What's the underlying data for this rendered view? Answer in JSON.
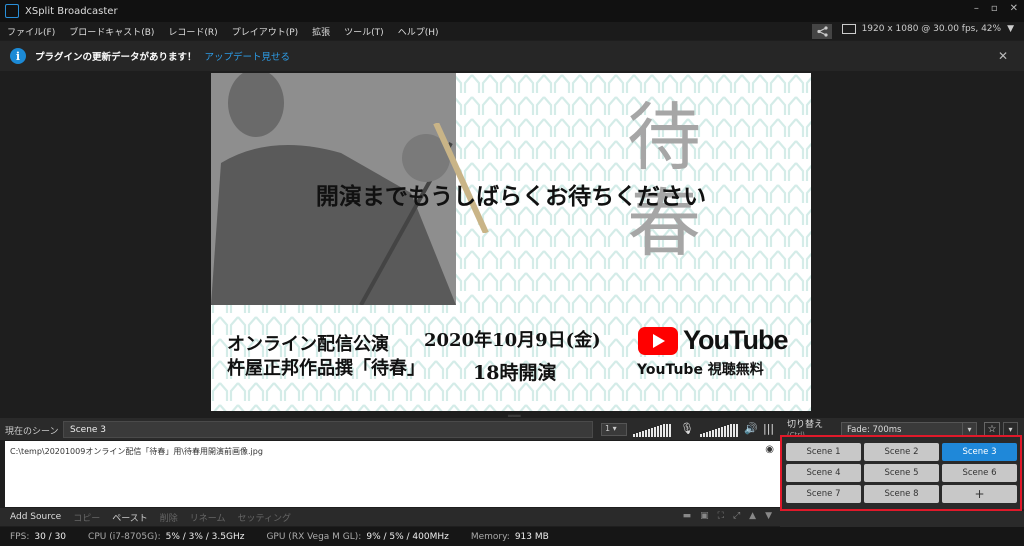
{
  "window": {
    "title": "XSplit Broadcaster",
    "minimize": "–",
    "maximize": "▫",
    "close": "✕"
  },
  "menu": [
    "ファイル(F)",
    "ブロードキャスト(B)",
    "レコード(R)",
    "プレイアウト(P)",
    "拡張",
    "ツール(T)",
    "ヘルプ(H)"
  ],
  "resolution": "1920 x 1080 @ 30.00 fps, 42%",
  "notification": {
    "text": "プラグインの更新データがあります！",
    "link": "アップデート見せる"
  },
  "preview": {
    "big_kanji": "待春",
    "headline": "開演までもうしばらくお待ちください",
    "event_line1": "オンライン配信公演",
    "event_line2": "杵屋正邦作品撰「待春」",
    "date": "2020年10月9日(金)",
    "time": "18時開演",
    "youtube_word": "YouTube",
    "youtube_caption": "YouTube 視聴無料"
  },
  "scene_bar": {
    "label": "現在のシーン",
    "current": "Scene 3",
    "selector": "1"
  },
  "sources": {
    "path": "C:\\temp\\20201009オンライン配信「待春」用\\待春用開演前画像.jpg"
  },
  "source_toolbar": {
    "add": "Add Source",
    "copy": "コピー",
    "paste": "ペースト",
    "delete": "削除",
    "rename": "リネーム",
    "settings": "セッティング"
  },
  "transition": {
    "label": "切り替え",
    "sublabel": "(Ctrl)",
    "value": "Fade: 700ms"
  },
  "scenes": [
    {
      "label": "Scene 1",
      "active": false
    },
    {
      "label": "Scene 2",
      "active": false
    },
    {
      "label": "Scene 3",
      "active": true
    },
    {
      "label": "Scene 4",
      "active": false
    },
    {
      "label": "Scene 5",
      "active": false
    },
    {
      "label": "Scene 6",
      "active": false
    },
    {
      "label": "Scene 7",
      "active": false
    },
    {
      "label": "Scene 8",
      "active": false
    },
    {
      "label": "+",
      "active": false
    }
  ],
  "status": {
    "fps_label": "FPS:",
    "fps": "30 / 30",
    "cpu_label": "CPU (i7-8705G):",
    "cpu": "5% / 3% / 3.5GHz",
    "gpu_label": "GPU (RX Vega M GL):",
    "gpu": "9% / 5% / 400MHz",
    "mem_label": "Memory:",
    "mem": "913 MB"
  },
  "colors": {
    "accent": "#1f88d9",
    "highlight": "#e0192a",
    "youtube": "#ff0000"
  }
}
